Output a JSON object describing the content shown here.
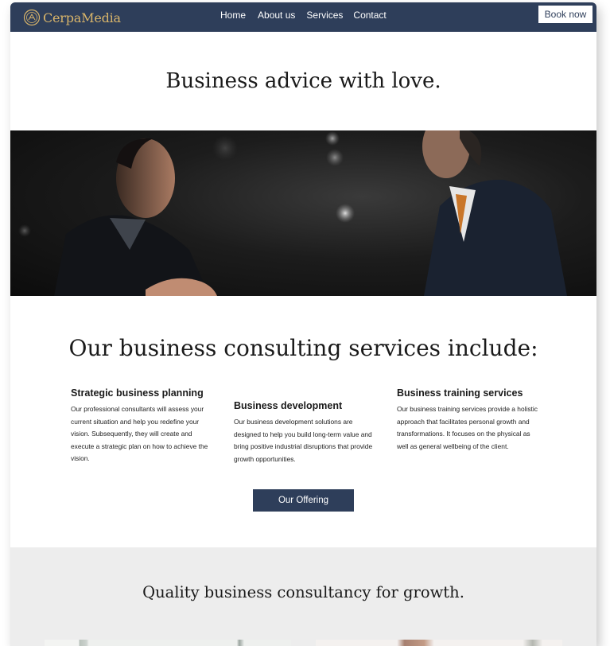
{
  "nav": {
    "brand": "CerpaMedia",
    "links": [
      "Home",
      "About us",
      "Services",
      "Contact"
    ],
    "book_label": "Book now"
  },
  "hero": {
    "title": "Business advice with love."
  },
  "services": {
    "title": "Our business consulting services include:",
    "items": [
      {
        "heading": "Strategic business planning",
        "body": "Our professional consultants will assess your current situation and help you redefine your vision. Subsequently, they will create and execute a strategic plan on how to achieve the vision."
      },
      {
        "heading": "Business development",
        "body": "Our business development solutions are designed to help you build long-term value and bring positive industrial disruptions that provide growth opportunities."
      },
      {
        "heading": "Business training services",
        "body": "Our business training services provide a holistic approach that facilitates personal growth and transformations. It focuses on the physical as well as general wellbeing of the client."
      }
    ],
    "cta_label": "Our Offering"
  },
  "quality": {
    "title": "Quality business consultancy for growth."
  },
  "colors": {
    "navy": "#2e3e5a",
    "gold": "#d9b56a",
    "section_gray": "#ededed"
  }
}
